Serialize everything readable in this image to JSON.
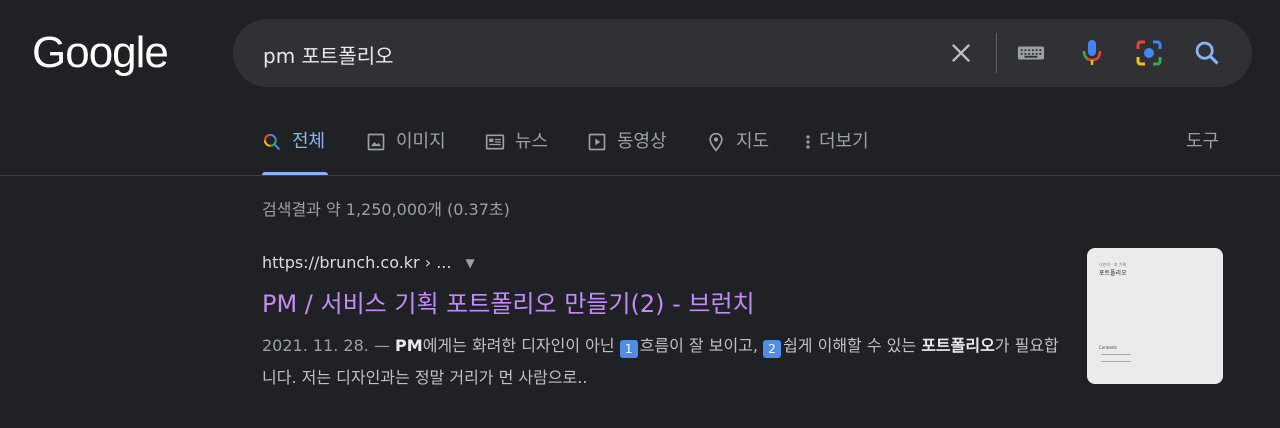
{
  "logo": {
    "text": "Google"
  },
  "search": {
    "query": "pm 포트폴리오"
  },
  "tabs": [
    {
      "label": "전체",
      "icon": "search-icon",
      "active": true
    },
    {
      "label": "이미지",
      "icon": "image-icon"
    },
    {
      "label": "뉴스",
      "icon": "news-icon"
    },
    {
      "label": "동영상",
      "icon": "video-icon"
    },
    {
      "label": "지도",
      "icon": "map-pin-icon"
    },
    {
      "label": "더보기",
      "icon": "more-vert-icon"
    }
  ],
  "tools_label": "도구",
  "stats": "검색결과 약 1,250,000개 (0.37초)",
  "result": {
    "url": "https://brunch.co.kr › ...",
    "title": "PM / 서비스 기획 포트폴리오 만들기(2) - 브런치",
    "date": "2021. 11. 28. —",
    "snippet_bold1": "PM",
    "snippet_text1": "에게는 화려한 디자인이 아닌 ",
    "key1": "1",
    "snippet_text2": "흐름이 잘 보이고, ",
    "key2": "2",
    "snippet_text3": "쉽게 이해할 수 있는 ",
    "snippet_bold2": "포트폴리오",
    "snippet_text4": "가 필요합니다. 저는 디자인과는 정말 거리가 먼 사람으로.."
  },
  "thumbnail": {
    "line1": "나만의 · 포 기획",
    "title": "포트폴리오",
    "contents": "Contents"
  },
  "colors": {
    "background": "#202124",
    "searchbox": "#303134",
    "link_visited": "#c58af9",
    "active_tab": "#8ab4f8"
  }
}
